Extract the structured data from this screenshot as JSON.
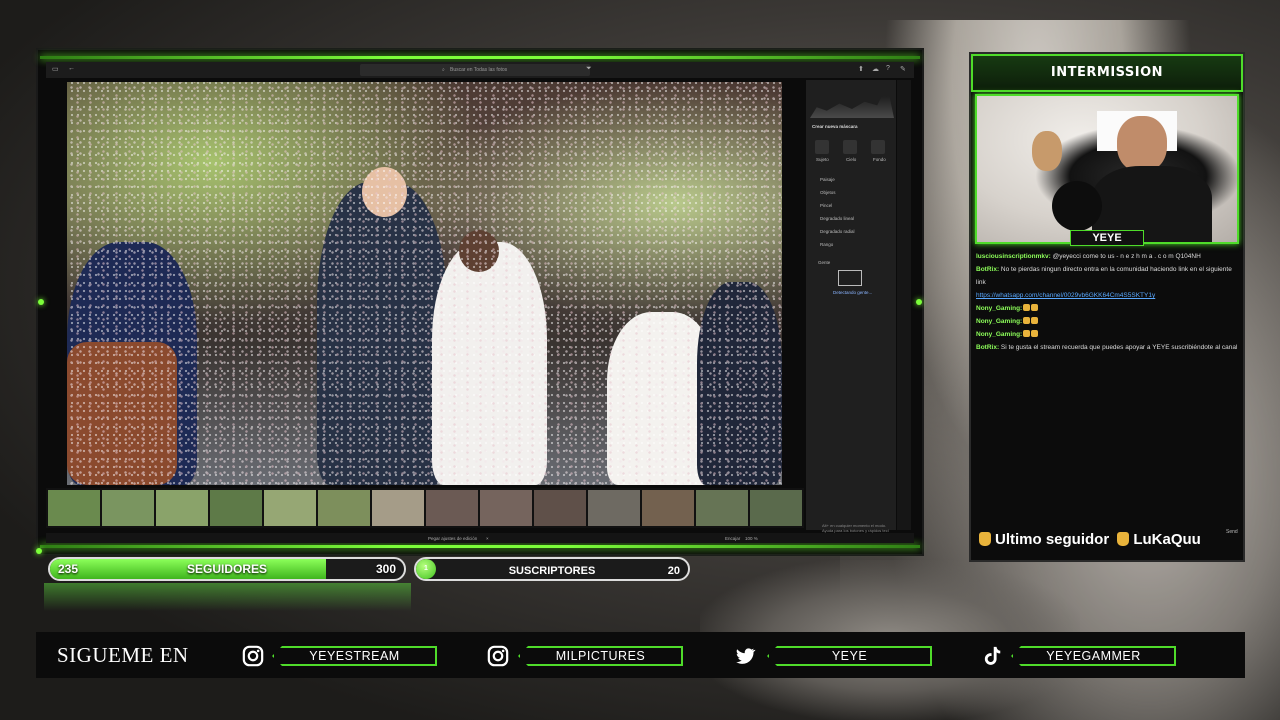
{
  "app": {
    "search_placeholder": "Buscar en Todas las fotos",
    "panel_title": "Crear nueva máscara",
    "mask_tiles": [
      "Sujeto",
      "Cielo",
      "Fondo"
    ],
    "mask_tools": [
      "Paisaje",
      "Objetos",
      "Pincel",
      "Degradado lineal",
      "Degradado radial",
      "Rango"
    ],
    "people_label": "Gente",
    "detecting_label": "Detectando gente...",
    "bottom_tab": "Pegar ajustes de edición",
    "zoom_label": "Encajar",
    "zoom_value": "100 %",
    "hint_text": "Alt+ en cualquier momento el modo. Ayuda para los botones y rápidos tecl"
  },
  "stats": {
    "seguidores_label": "SEGUIDORES",
    "seguidores_current": "235",
    "seguidores_goal": "300",
    "seguidores_progress": 0.78,
    "suscriptores_label": "SUSCRIPTORES",
    "suscriptores_current": "1",
    "suscriptores_goal": "20"
  },
  "side": {
    "title": "INTERMISSION",
    "cam_name": "YEYE",
    "ultimo_label": "Ultimo seguidor",
    "ultimo_user": "LuKaQuu",
    "send_label": "Send"
  },
  "chat": [
    {
      "user": "lusciousinscriptionmkv:",
      "text": "@yeyecci come to us - n e z h m a . c o m Q104NH",
      "type": "normal"
    },
    {
      "user": "BotRix:",
      "text": "No te pierdas ningun directo entra en la comunidad haciendo link en el siguiente link",
      "type": "normal"
    },
    {
      "user": "",
      "text": "https://whatsapp.com/channel/0029vb6GKK64Cm4S5SKTY1y",
      "type": "link"
    },
    {
      "user": "Nony_Gaming:",
      "text": "",
      "type": "emote"
    },
    {
      "user": "Nony_Gaming:",
      "text": "",
      "type": "emote"
    },
    {
      "user": "Nony_Gaming:",
      "text": "",
      "type": "emote"
    },
    {
      "user": "BotRix:",
      "text": "Si te gusta el stream recuerda que puedes apoyar a YEYE suscribiéndote al canal",
      "type": "normal"
    }
  ],
  "social": {
    "heading": "SIGUEME EN",
    "accounts": [
      {
        "icon": "instagram-icon",
        "handle": "YEYESTREAM"
      },
      {
        "icon": "instagram-icon",
        "handle": "MILPICTURES"
      },
      {
        "icon": "twitter-icon",
        "handle": "YEYE"
      },
      {
        "icon": "tiktok-icon",
        "handle": "YEYEGAMMER"
      }
    ]
  },
  "colors": {
    "accent": "#4fdc2a",
    "accent_bright": "#7cff3a",
    "link": "#5aa9ff"
  }
}
